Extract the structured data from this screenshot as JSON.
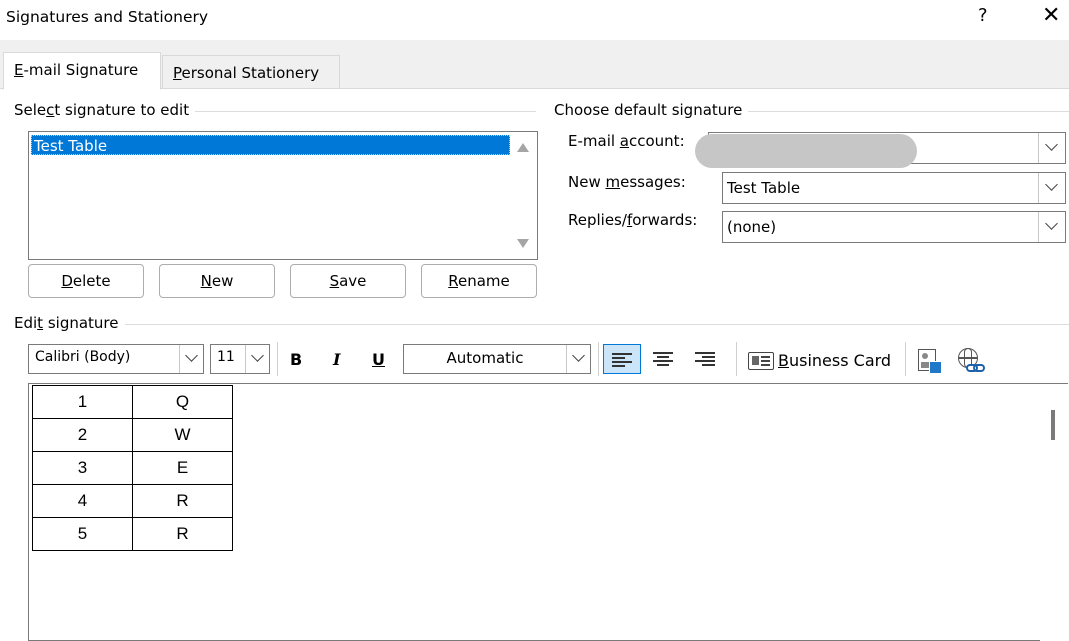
{
  "window": {
    "title": "Signatures and Stationery",
    "help": "?",
    "close": "✕"
  },
  "tabs": [
    {
      "label": "E-mail Signature",
      "underline": "E",
      "rest": "-mail Signature"
    },
    {
      "label": "Personal Stationery",
      "underline": "P",
      "rest": "ersonal Stationery"
    }
  ],
  "select_group": {
    "label_a": "Sele",
    "label_u": "c",
    "label_b": "t signature to edit",
    "items": [
      "Test Table"
    ],
    "buttons": [
      {
        "u": "D",
        "rest": "elete"
      },
      {
        "u": "N",
        "rest": "ew"
      },
      {
        "u": "S",
        "rest": "ave"
      },
      {
        "u": "R",
        "rest": "ename"
      }
    ]
  },
  "default_group": {
    "label": "Choose default signature",
    "email_account": {
      "a": "E-mail ",
      "u": "a",
      "b": "ccount:",
      "value": ""
    },
    "new_messages": {
      "a": "New ",
      "u": "m",
      "b": "essages:",
      "value": "Test Table"
    },
    "replies": {
      "a": "Replies/",
      "u": "f",
      "b": "orwards:",
      "value": "(none)"
    }
  },
  "edit_group": {
    "label_a": "Edi",
    "label_u": "t",
    "label_b": " signature",
    "font": "Calibri (Body)",
    "size": "11",
    "bold": "B",
    "italic": "I",
    "underline": "U",
    "color": "Automatic",
    "business_card": {
      "u": "B",
      "rest": "usiness Card"
    }
  },
  "signature_table": [
    [
      "1",
      "Q"
    ],
    [
      "2",
      "W"
    ],
    [
      "3",
      "E"
    ],
    [
      "4",
      "R"
    ],
    [
      "5",
      "R"
    ]
  ],
  "colors": {
    "selection": "#0078d7",
    "border": "#7a7a7a",
    "window_bg": "#f0f0f0"
  }
}
